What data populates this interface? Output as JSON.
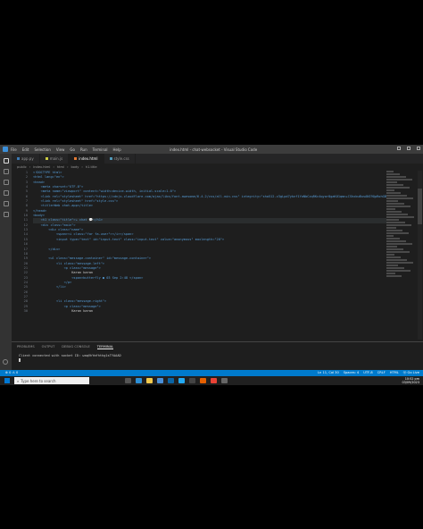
{
  "window": {
    "title": "index.html - chat-websocket - Visual Studio Code",
    "menu": [
      "File",
      "Edit",
      "Selection",
      "View",
      "Go",
      "Run",
      "Terminal",
      "Help"
    ]
  },
  "tabs": [
    {
      "label": "app.py",
      "kind": "py"
    },
    {
      "label": "main.js",
      "kind": "js"
    },
    {
      "label": "index.html",
      "kind": "html",
      "active": true
    },
    {
      "label": "style.css",
      "kind": "css"
    }
  ],
  "breadcrumb": [
    "public",
    "index.html",
    "html",
    "body",
    "h1.title"
  ],
  "editor": {
    "line_numbers": [
      "1",
      "2",
      "3",
      "4",
      "5",
      "6",
      "7",
      "8",
      "9",
      "10",
      "11",
      "12",
      "13",
      "14",
      "15",
      "16",
      "17",
      "18",
      "19",
      "20",
      "21",
      "22",
      "23",
      "24",
      "25",
      "26",
      "27",
      "28",
      "29",
      "30",
      "31",
      "32",
      "33",
      "34",
      "35"
    ],
    "lines": [
      "<!DOCTYPE html>",
      "<html lang=\"en\">",
      "<head>",
      "    <meta charset=\"UTF-8\">",
      "    <meta name=\"viewport\" content=\"width=device-width, initial-scale=1.0\">",
      "    <link rel=\"stylesheet\" href=\"https://cdnjs.cloudflare.com/ajax/libs/font-awesome/6.4.2/css/all.min.css\" integrity=\"sha512-z3gLpd7yknf1YoNbCzqRKc4qyor8gaKU1qmn+CShxbuBusANI9QpRohGBreCFkKxLhei6S9CQXFEbbKuqLg0DA==\"",
      "    <link rel=\"stylesheet\" href=\"style.css\">",
      "    <title>Web chat-app</title>",
      "</head>",
      "<body>",
      "    <h1 class=\"title\">☕ chat 💬</h1>",
      "    <div class=\"main\">",
      "        <div class=\"name\">",
      "            <span><i class=\"far fa-user\"></i></span>",
      "            <input type=\"text\" id=\"input-text\" class=\"input-text\" value=\"anonymous\" maxlength=\"20\">",
      "",
      "        </div>",
      "",
      "        <ul class=\"message-container\" id=\"message-container\">",
      "            <li class=\"message-left\">",
      "                <p class=\"message\">",
      "                    Karan karan",
      "                    <span>butterfly ● 03 Sep 2:48 </span>",
      "                </p>",
      "            </li>",
      "",
      "",
      "            <li class=\"message-right\">",
      "                <p class=\"message\">",
      "                    Karan karan"
    ]
  },
  "panel": {
    "tabs": [
      "PROBLEMS",
      "OUTPUT",
      "DEBUG CONSOLE",
      "TERMINAL"
    ],
    "active_tab": "TERMINAL",
    "terminal_output": "Client connected with socket ID: waqVhYmfhthg1sTYAAAD"
  },
  "statusbar": {
    "left": "⊗ 0 ⚠ 0",
    "right": [
      "Ln 11, Col 30",
      "Spaces: 4",
      "UTF-8",
      "CRLF",
      "HTML",
      "ⓦ Go Live"
    ]
  },
  "taskbar": {
    "search_placeholder": "Type here to search",
    "time": "10:52 pm",
    "date": "03/09/2023"
  }
}
